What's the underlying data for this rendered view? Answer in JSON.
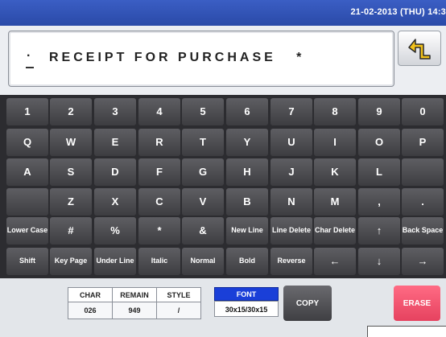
{
  "header": {
    "datetime": "21-02-2013 (THU) 14:3"
  },
  "editor": {
    "cursor_glyph": "·",
    "text": "RECEIPT FOR PURCHASE   *"
  },
  "icons": {
    "back": "return-arrow-icon",
    "up": "arrow-up-icon",
    "down": "arrow-down-icon",
    "left": "arrow-left-icon",
    "right": "arrow-right-icon"
  },
  "keys": {
    "row1": [
      "1",
      "2",
      "3",
      "4",
      "5",
      "6",
      "7",
      "8",
      "9",
      "0"
    ],
    "row2": [
      "Q",
      "W",
      "E",
      "R",
      "T",
      "Y",
      "U",
      "I",
      "O",
      "P"
    ],
    "row3": [
      "A",
      "S",
      "D",
      "F",
      "G",
      "H",
      "J",
      "K",
      "L",
      ""
    ],
    "row4": [
      "",
      "Z",
      "X",
      "C",
      "V",
      "B",
      "N",
      "M",
      ",",
      "."
    ],
    "row5": [
      "Lower Case",
      "#",
      "%",
      "*",
      "&",
      "New Line",
      "Line Delete",
      "Char Delete",
      "↑",
      "Back Space"
    ],
    "row6": [
      "Shift",
      "Key Page",
      "Under Line",
      "Italic",
      "Normal",
      "Bold",
      "Reverse",
      "←",
      "↓",
      "→"
    ]
  },
  "status": {
    "char_label": "CHAR",
    "char_value": "026",
    "remain_label": "REMAIN",
    "remain_value": "949",
    "style_label": "STYLE",
    "style_value": "/",
    "font_label": "FONT",
    "font_value": "30x15/30x15"
  },
  "actions": {
    "copy": "COPY",
    "erase": "ERASE"
  },
  "colors": {
    "header": "#2a4aa8",
    "key": "#4a4a4f",
    "font_header": "#1a3fd8",
    "erase": "#f0506c"
  }
}
